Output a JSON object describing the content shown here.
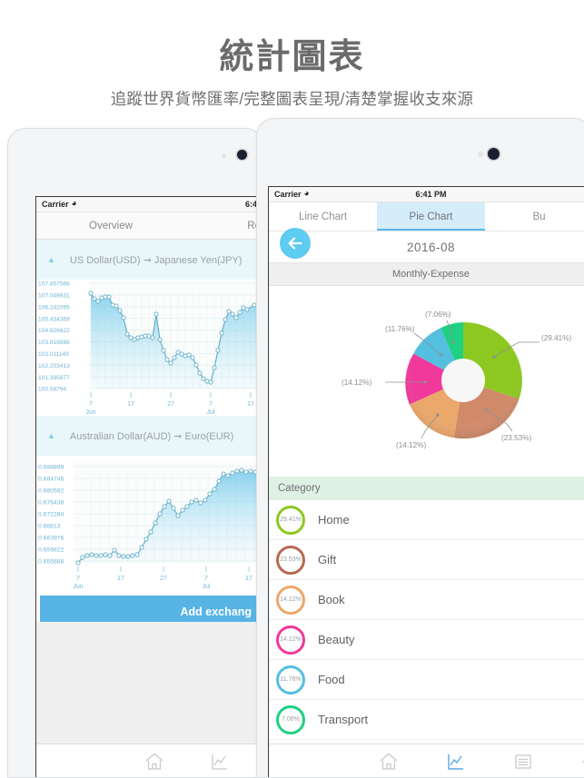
{
  "header": {
    "title": "統計圖表",
    "subtitle": "追蹤世界貨幣匯率/完整圖表呈現/清楚掌握收支來源"
  },
  "left_device": {
    "status": {
      "carrier": "Carrier",
      "wifi_icon": "wifi-icon",
      "time": "6:4"
    },
    "segments": {
      "overview": "Overview",
      "refresh": "Re"
    },
    "sections": [
      {
        "caret_icon": "chevron-up-icon",
        "from": "US Dollar(USD)",
        "arrow": "→",
        "to": "Japanese Yen(JPY)",
        "title": "US Dollar(USD) ➞ Japanese Yen(JPY)"
      },
      {
        "caret_icon": "chevron-up-icon",
        "from": "Australian Dollar(AUD)",
        "arrow": "→",
        "to": "Euro(EUR)",
        "title": "Australian Dollar(AUD) ➞ Euro(EUR)"
      }
    ],
    "add_button": "Add exchang",
    "tabbar": [
      {
        "icon": "home-icon",
        "active": false
      },
      {
        "icon": "chart-icon",
        "active": false
      }
    ]
  },
  "right_device": {
    "status": {
      "carrier": "Carrier",
      "wifi_icon": "wifi-icon",
      "time": "6:41 PM"
    },
    "tabs": [
      {
        "label": "Line Chart",
        "active": false
      },
      {
        "label": "Pie Chart",
        "active": true
      },
      {
        "label": "Bu",
        "active": false
      }
    ],
    "back_icon": "back-arrow-icon",
    "month": "2016-08",
    "chart_header": "Monthly-Expense",
    "category_header": "Category",
    "categories": [
      {
        "label": "Home",
        "percent": "29.41%",
        "color": "#8dc820"
      },
      {
        "label": "Gift",
        "percent": "23.53%",
        "color": "#b56a52"
      },
      {
        "label": "Book",
        "percent": "14.12%",
        "color": "#eaa86b"
      },
      {
        "label": "Beauty",
        "percent": "14.12%",
        "color": "#f0399b"
      },
      {
        "label": "Food",
        "percent": "11.76%",
        "color": "#55bfe0"
      },
      {
        "label": "Transport",
        "percent": "7.06%",
        "color": "#1fd182"
      }
    ],
    "tabbar": [
      {
        "icon": "home-icon",
        "active": false
      },
      {
        "icon": "chart-icon",
        "active": true
      },
      {
        "icon": "list-icon",
        "active": false
      },
      {
        "icon": "gear-icon",
        "active": false
      }
    ]
  },
  "chart_data": [
    {
      "type": "line",
      "title": "US Dollar(USD) to Japanese Yen(JPY)",
      "ylabel": "",
      "xlabel": "",
      "ytick_labels": [
        "107.857568",
        "107.049831",
        "106.242095",
        "105.434358",
        "104.626622",
        "103.818886",
        "103.011149",
        "102.203413",
        "101.395677",
        "100.58794"
      ],
      "ylim": [
        100.58794,
        107.857568
      ],
      "xtick_labels": [
        "7",
        "17",
        "27",
        "7",
        "17"
      ],
      "xtick_months": [
        "Jun",
        "",
        "",
        "Jul",
        ""
      ],
      "grid": true,
      "values": [
        107.05,
        106.85,
        106.6,
        106.75,
        106.78,
        106.8,
        106.3,
        106.25,
        105.9,
        105.4,
        104.3,
        104.0,
        103.9,
        104.0,
        104.05,
        104.1,
        104.1,
        104.0,
        105.3,
        103.6,
        102.8,
        102.2,
        101.9,
        102.3,
        102.6,
        102.5,
        102.4,
        102.45,
        102.3,
        101.8,
        101.2,
        100.8,
        100.6,
        100.58,
        101.4,
        102.6,
        103.8,
        104.8,
        105.4,
        105.2,
        105.0,
        105.3,
        105.6,
        105.5
      ]
    },
    {
      "type": "line",
      "title": "Australian Dollar(AUD) to Euro(EUR)",
      "ylabel": "",
      "xlabel": "",
      "ytick_labels": [
        "0.688899",
        "0.684746",
        "0.680592",
        "0.676438",
        "0.672284",
        "0.66813",
        "0.663976",
        "0.659822",
        "0.655668"
      ],
      "ylim": [
        0.655668,
        0.688899
      ],
      "xtick_labels": [
        "7",
        "17",
        "27",
        "7",
        "17"
      ],
      "xtick_months": [
        "Jun",
        "",
        "",
        "Jul",
        ""
      ],
      "grid": true,
      "values": [
        0.6545,
        0.6555,
        0.6562,
        0.656,
        0.6558,
        0.656,
        0.6562,
        0.656,
        0.6572,
        0.656,
        0.6558,
        0.6557,
        0.6558,
        0.656,
        0.6575,
        0.6598,
        0.662,
        0.665,
        0.668,
        0.6705,
        0.6722,
        0.67,
        0.668,
        0.6692,
        0.6705,
        0.6718,
        0.6722,
        0.6716,
        0.6722,
        0.6745,
        0.676,
        0.68,
        0.6845,
        0.6838,
        0.685,
        0.686,
        0.6865,
        0.6858,
        0.686,
        0.6858,
        0.6856,
        0.6848
      ]
    },
    {
      "type": "pie",
      "title": "Monthly-Expense",
      "subtitle": "2016-08",
      "donut": true,
      "categories": [
        "Home",
        "Gift",
        "Book",
        "Beauty",
        "Food",
        "Transport"
      ],
      "values": [
        29.41,
        23.53,
        14.12,
        14.12,
        11.76,
        7.06
      ],
      "labels": [
        "(29.41%)",
        "(23.53%)",
        "(14.12%)",
        "(14.12%)",
        "(11.76%)",
        "(7.06%)"
      ],
      "colors": [
        "#8dc820",
        "#d08a6a",
        "#eaa86b",
        "#f0399b",
        "#55bfe0",
        "#1fd182"
      ],
      "legend": "right"
    }
  ]
}
